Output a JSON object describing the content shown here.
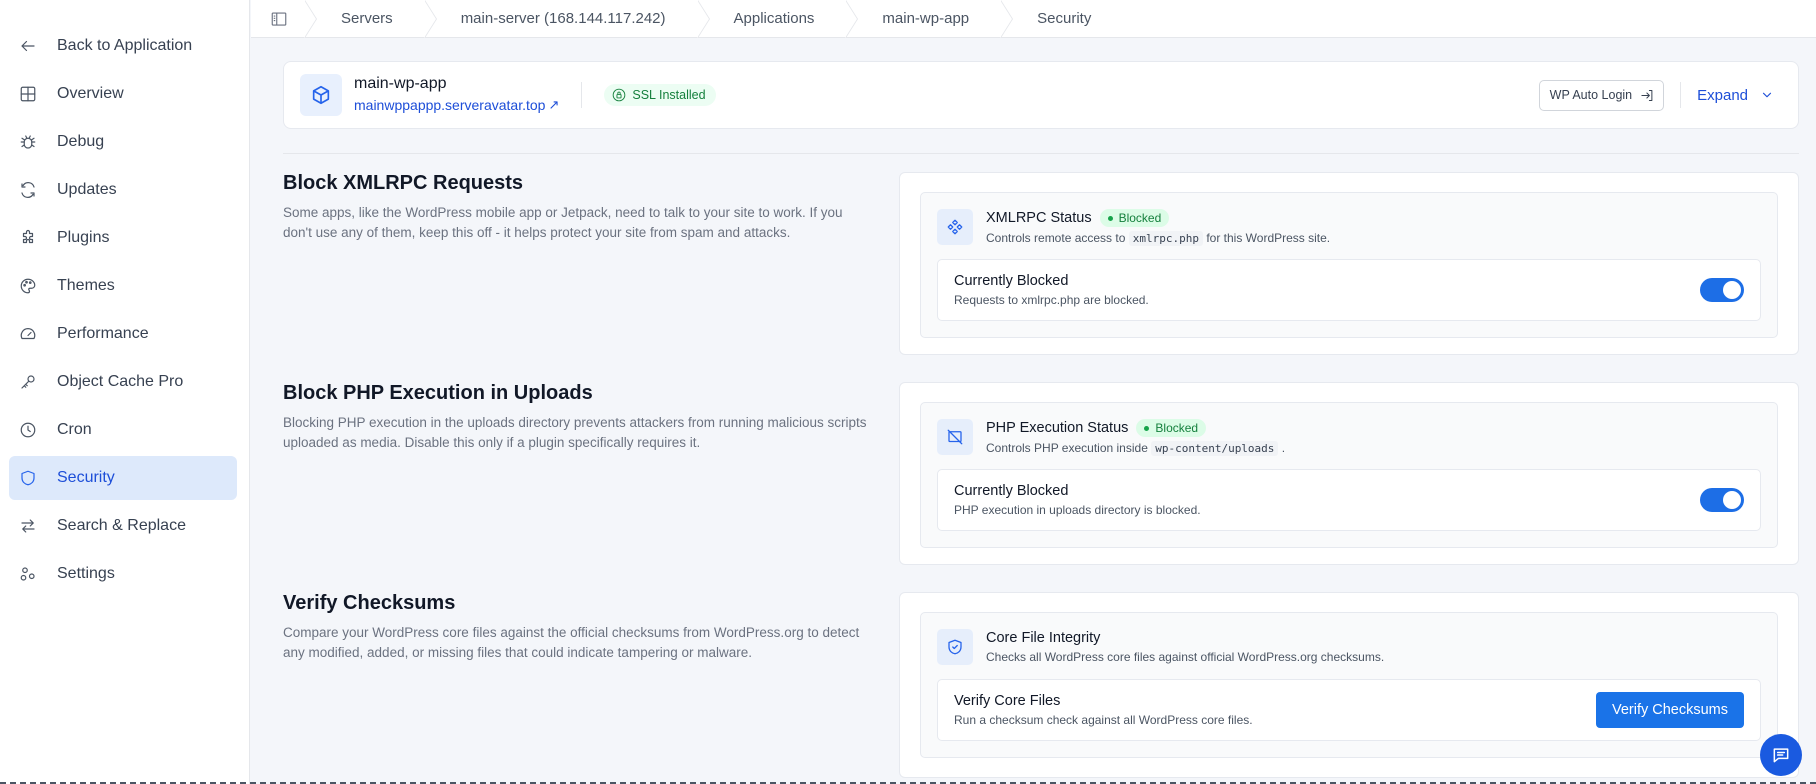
{
  "sidebar": {
    "items": [
      {
        "label": "Back to Application",
        "icon": "arrow-left-icon"
      },
      {
        "label": "Overview",
        "icon": "grid-icon"
      },
      {
        "label": "Debug",
        "icon": "bug-icon"
      },
      {
        "label": "Updates",
        "icon": "refresh-icon"
      },
      {
        "label": "Plugins",
        "icon": "puzzle-icon"
      },
      {
        "label": "Themes",
        "icon": "palette-icon"
      },
      {
        "label": "Performance",
        "icon": "gauge-icon"
      },
      {
        "label": "Object Cache Pro",
        "icon": "key-icon"
      },
      {
        "label": "Cron",
        "icon": "clock-icon"
      },
      {
        "label": "Security",
        "icon": "shield-icon",
        "active": true
      },
      {
        "label": "Search & Replace",
        "icon": "swap-icon"
      },
      {
        "label": "Settings",
        "icon": "settings-icon"
      }
    ]
  },
  "breadcrumb": {
    "items": [
      "Servers",
      "main-server (168.144.117.242)",
      "Applications",
      "main-wp-app",
      "Security"
    ]
  },
  "app": {
    "name": "main-wp-app",
    "url": "mainwppappp.serveravatar.top",
    "ssl_label": "SSL Installed",
    "wp_login_label": "WP Auto Login",
    "expand_label": "Expand"
  },
  "sections": {
    "xmlrpc": {
      "title": "Block XMLRPC Requests",
      "description": "Some apps, like the WordPress mobile app or Jetpack, need to talk to your site to work. If you don't use any of them, keep this off - it helps protect your site from spam and attacks.",
      "status_title": "XMLRPC Status",
      "status_badge": "Blocked",
      "status_sub_before": "Controls remote access to",
      "status_sub_code": "xmlrpc.php",
      "status_sub_after": "for this WordPress site.",
      "state_title": "Currently Blocked",
      "state_sub": "Requests to xmlrpc.php are blocked.",
      "enabled": true
    },
    "php_exec": {
      "title": "Block PHP Execution in Uploads",
      "description": "Blocking PHP execution in the uploads directory prevents attackers from running malicious scripts uploaded as media. Disable this only if a plugin specifically requires it.",
      "status_title": "PHP Execution Status",
      "status_badge": "Blocked",
      "status_sub_before": "Controls PHP execution inside",
      "status_sub_code": "wp-content/uploads",
      "status_sub_after": ".",
      "state_title": "Currently Blocked",
      "state_sub": "PHP execution in uploads directory is blocked.",
      "enabled": true
    },
    "checksums": {
      "title": "Verify Checksums",
      "description": "Compare your WordPress core files against the official checksums from WordPress.org to detect any modified, added, or missing files that could indicate tampering or malware.",
      "status_title": "Core File Integrity",
      "status_sub": "Checks all WordPress core files against official WordPress.org checksums.",
      "state_title": "Verify Core Files",
      "state_sub": "Run a checksum check against all WordPress core files.",
      "button_label": "Verify Checksums"
    }
  },
  "colors": {
    "accent": "#1a73e8",
    "success": "#15803d",
    "active_nav_bg": "#dde9fb"
  }
}
